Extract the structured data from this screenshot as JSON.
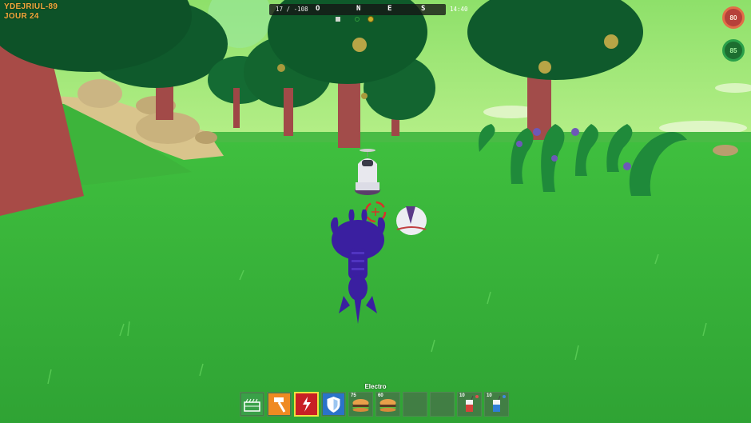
{
  "player": {
    "name": "YDEJRIUL-89",
    "day": "JOUR 24"
  },
  "compass": {
    "coords": "17 / -108",
    "directions": [
      "O",
      "N",
      "E",
      "S"
    ],
    "time": "14:40"
  },
  "gauges": {
    "health": "80",
    "oxygen": "85"
  },
  "toolbar": {
    "selected_label": "Electro",
    "slots": [
      {
        "icon": "crate-icon",
        "count": ""
      },
      {
        "icon": "hammer-icon",
        "count": ""
      },
      {
        "icon": "electro-icon",
        "count": ""
      },
      {
        "icon": "shield-icon",
        "count": ""
      },
      {
        "icon": "burger-icon",
        "count": "75"
      },
      {
        "icon": "burger-icon",
        "count": "60"
      },
      {
        "icon": "",
        "count": ""
      },
      {
        "icon": "",
        "count": ""
      },
      {
        "icon": "red-drink-icon",
        "count": "10"
      },
      {
        "icon": "blue-drink-icon",
        "count": "10"
      }
    ]
  },
  "colors": {
    "sky": "#7ed957",
    "grass": "#35b53a",
    "accent": "#f3a63a",
    "creature": "#3a1fa0"
  }
}
